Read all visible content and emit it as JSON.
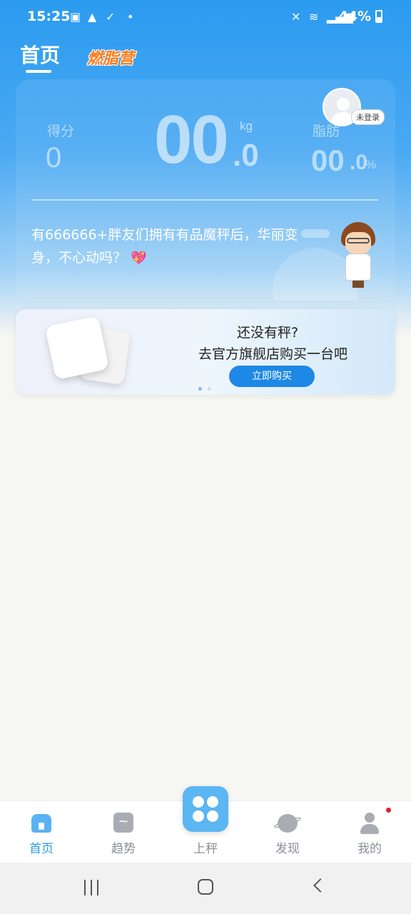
{
  "status_bar": {
    "time": "15:25",
    "battery": "44%",
    "icons": [
      "image-icon",
      "warning-icon",
      "check-icon",
      "dot-icon",
      "mute-icon",
      "wifi-icon",
      "signal-icon",
      "battery-icon"
    ]
  },
  "top_tabs": {
    "home": "首页",
    "burn_camp": "燃脂营"
  },
  "stats": {
    "score_label": "得分",
    "score_value": "0",
    "weight_value": "00",
    "weight_decimal": ".0",
    "weight_unit": "kg",
    "fat_label": "脂肪",
    "fat_value": "00",
    "fat_decimal": ".0",
    "fat_unit": "%"
  },
  "avatar": {
    "badge": "未登录"
  },
  "promo": {
    "text": "有666666+胖友们拥有有品魔秤后，华丽变身，不心动吗？",
    "emoji": "💖"
  },
  "banner": {
    "title": "还没有秤?",
    "subtitle": "去官方旗舰店购买一台吧",
    "button": "立即购买",
    "page_dots": 2,
    "active_dot": 1
  },
  "bottom_nav": {
    "items": [
      {
        "label": "首页",
        "icon": "home-icon",
        "active": true
      },
      {
        "label": "趋势",
        "icon": "trend-icon",
        "active": false
      },
      {
        "label": "上秤",
        "icon": "weigh-icon",
        "active": false
      },
      {
        "label": "发现",
        "icon": "planet-icon",
        "active": false
      },
      {
        "label": "我的",
        "icon": "user-icon",
        "active": false,
        "badge_dot": true
      }
    ]
  },
  "colors": {
    "primary": "#2a9cf0",
    "button": "#1e88e5",
    "burn_orange": "#ff7a1a",
    "badge_red": "#e0202a"
  }
}
